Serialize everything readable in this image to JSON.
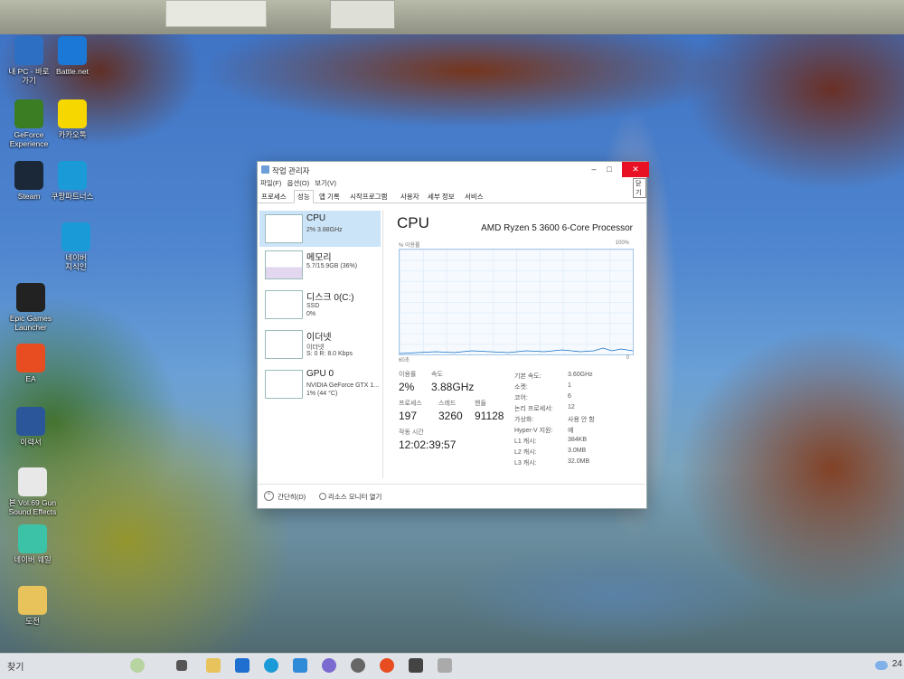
{
  "desktop": {
    "icons": [
      {
        "label": "내 PC - 바로\n가기",
        "icon": "pc-icon",
        "color": "#2d6fc2"
      },
      {
        "label": "Battle.net",
        "icon": "battlenet-icon",
        "color": "#1c78d6"
      },
      {
        "label": "GeForce\nExperience",
        "icon": "geforce-icon",
        "color": "#3a7d22"
      },
      {
        "label": "카카오톡",
        "icon": "kakaotalk-icon",
        "color": "#f7d700"
      },
      {
        "label": "Steam",
        "icon": "steam-icon",
        "color": "#1b2838"
      },
      {
        "label": "쿠팡파트너스",
        "icon": "edge-icon",
        "color": "#1a9bd7"
      },
      {
        "label": "네이버\n지식인",
        "icon": "edge-shortcut-icon",
        "color": "#1a9bd7"
      },
      {
        "label": "Epic Games\nLauncher",
        "icon": "epic-games-icon",
        "color": "#222222"
      },
      {
        "label": "EA",
        "icon": "ea-icon",
        "color": "#e84d22"
      },
      {
        "label": "이력서",
        "icon": "word-document-icon",
        "color": "#2b579a"
      },
      {
        "label": "본 Vol.69 Gun\nSound Effects",
        "icon": "archive-icon",
        "color": "#e8e8e8"
      },
      {
        "label": "네이버 웨일",
        "icon": "whale-icon",
        "color": "#3cc2a6"
      },
      {
        "label": "도전",
        "icon": "folder-icon",
        "color": "#e8c25a"
      }
    ]
  },
  "taskbar": {
    "search": "찾기",
    "time": "24"
  },
  "window": {
    "title": "작업 관리자",
    "tooltip": "닫기",
    "menu": [
      "파일(F)",
      "옵션(O)",
      "보기(V)"
    ],
    "tabs": [
      "프로세스",
      "성능",
      "앱 기록",
      "시작프로그램",
      "사용자",
      "세부 정보",
      "서비스"
    ],
    "active_tab": "성능",
    "sidebar": [
      {
        "name": "CPU",
        "sub1": "2% 3.88GHz",
        "sub2": ""
      },
      {
        "name": "메모리",
        "sub1": "5.7/15.9GB (36%)",
        "sub2": ""
      },
      {
        "name": "디스크 0(C:)",
        "sub1": "SSD",
        "sub2": "0%"
      },
      {
        "name": "이더넷",
        "sub1": "이더넷",
        "sub2": "S: 0 R: 8.0 Kbps"
      },
      {
        "name": "GPU 0",
        "sub1": "NVIDIA GeForce GTX 1...",
        "sub2": "1% (44 °C)"
      }
    ],
    "main": {
      "heading": "CPU",
      "processor": "AMD Ryzen 5 3600 6-Core Processor",
      "util_label": "% 이용률",
      "pct100": "100%",
      "time_left": "60초",
      "time_right": "0",
      "stats": {
        "utilization_label": "이용률",
        "utilization": "2%",
        "speed_label": "속도",
        "speed": "3.88GHz",
        "processes_label": "프로세스",
        "processes": "197",
        "threads_label": "스레드",
        "threads": "3260",
        "handles_label": "핸들",
        "handles": "91128",
        "uptime_label": "작동 시간",
        "uptime": "12:02:39:57"
      },
      "specs": [
        {
          "k": "기본 속도:",
          "v": "3.60GHz"
        },
        {
          "k": "소켓:",
          "v": "1"
        },
        {
          "k": "코어:",
          "v": "6"
        },
        {
          "k": "논리 프로세서:",
          "v": "12"
        },
        {
          "k": "가상화:",
          "v": "사용 안 함"
        },
        {
          "k": "Hyper-V 지원:",
          "v": "예"
        },
        {
          "k": "L1 캐시:",
          "v": "384KB"
        },
        {
          "k": "L2 캐시:",
          "v": "3.0MB"
        },
        {
          "k": "L3 캐시:",
          "v": "32.0MB"
        }
      ]
    },
    "footer": {
      "less": "간단히(D)",
      "monitor": "리소스 모니터 열기"
    }
  }
}
